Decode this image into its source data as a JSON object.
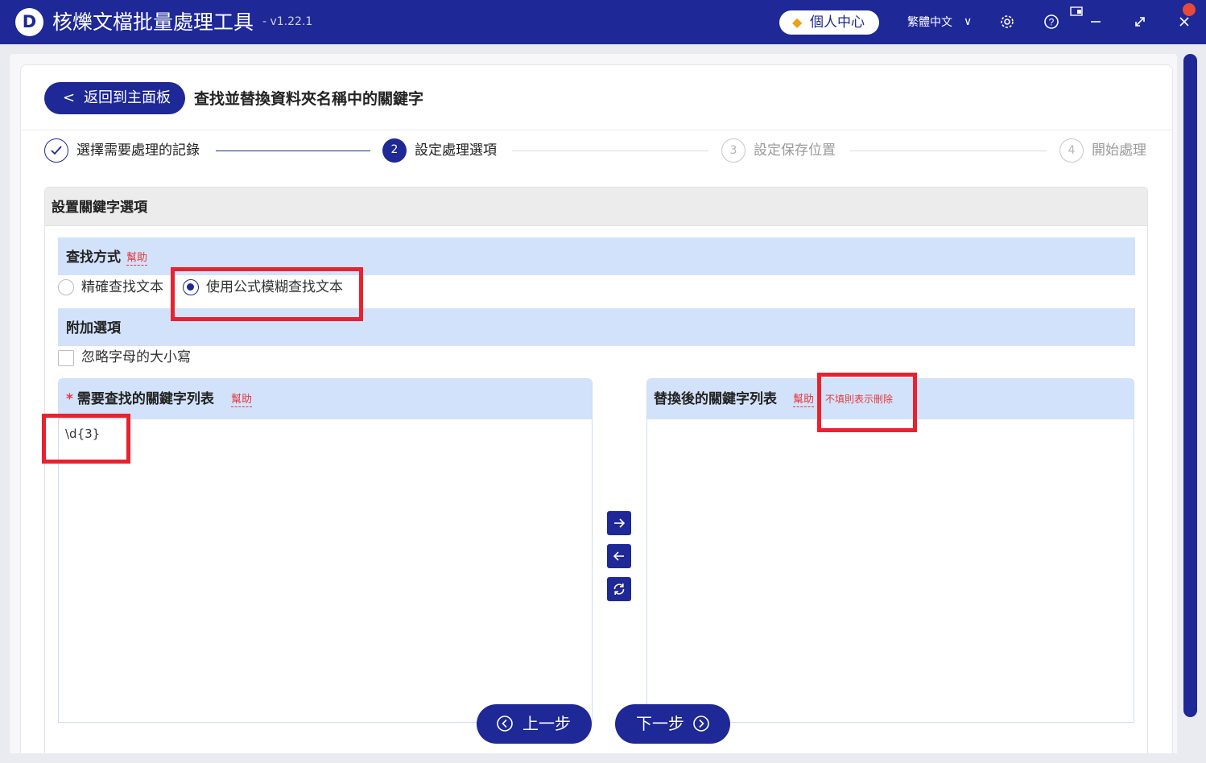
{
  "app": {
    "logo_letter": "D",
    "title": "核爍文檔批量處理工具",
    "version": "- v1.22.1",
    "user_center": "個人中心",
    "language": "繁體中文"
  },
  "icons": {
    "gem": "gem-icon",
    "settings": "gear-icon",
    "help": "help-circle-icon",
    "minimize": "minimize-icon",
    "maximize": "maximize-icon",
    "close": "close-icon"
  },
  "header": {
    "back_label": "返回到主面板",
    "page_title": "查找並替換資料夾名稱中的關鍵字"
  },
  "steps": [
    {
      "num": "✓",
      "label": "選擇需要處理的記錄",
      "state": "done"
    },
    {
      "num": "2",
      "label": "設定處理選項",
      "state": "active"
    },
    {
      "num": "3",
      "label": "設定保存位置",
      "state": "todo"
    },
    {
      "num": "4",
      "label": "開始處理",
      "state": "todo"
    }
  ],
  "panel": {
    "title": "設置關鍵字選項",
    "search_mode": {
      "title": "查找方式",
      "help": "幫助",
      "options": [
        "精確查找文本",
        "使用公式模糊查找文本"
      ],
      "selected_index": 1
    },
    "extra": {
      "title": "附加選項",
      "ignore_case": "忽略字母的大小寫",
      "ignore_case_checked": false
    },
    "find_list": {
      "required_mark": "*",
      "title": "需要查找的關鍵字列表",
      "help": "幫助",
      "value": "\\d{3}"
    },
    "replace_list": {
      "title": "替換後的關鍵字列表",
      "help": "幫助",
      "hint": "不填則表示刪除",
      "value": ""
    }
  },
  "nav": {
    "prev": "上一步",
    "next": "下一步"
  },
  "colors": {
    "brand": "#1e2896",
    "section_bg": "#d3e2fb",
    "highlight": "#e8222e",
    "help_red": "#e53a3a"
  }
}
